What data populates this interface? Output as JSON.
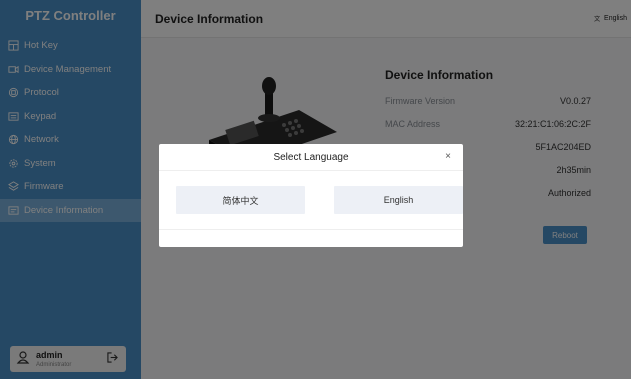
{
  "sidebar": {
    "brand": "PTZ Controller",
    "items": [
      {
        "label": "Hot Key",
        "icon": "hotkey-icon"
      },
      {
        "label": "Device Management",
        "icon": "device-management-icon"
      },
      {
        "label": "Protocol",
        "icon": "protocol-icon"
      },
      {
        "label": "Keypad",
        "icon": "keypad-icon"
      },
      {
        "label": "Network",
        "icon": "network-icon"
      },
      {
        "label": "System",
        "icon": "system-icon"
      },
      {
        "label": "Firmware",
        "icon": "firmware-icon"
      },
      {
        "label": "Device Information",
        "icon": "device-information-icon"
      }
    ],
    "active_index": 7,
    "user": {
      "name": "admin",
      "role": "Administrator"
    }
  },
  "header": {
    "title": "Device Information",
    "language": "English"
  },
  "info": {
    "heading": "Device Information",
    "rows": [
      {
        "label": "Firmware Version",
        "value": "V0.0.27"
      },
      {
        "label": "MAC Address",
        "value": "32:21:C1:06:2C:2F"
      },
      {
        "label": "",
        "value": "5F1AC204ED"
      },
      {
        "label": "",
        "value": "2h35min"
      },
      {
        "label": "",
        "value": "Authorized"
      }
    ],
    "reboot_label": "Reboot"
  },
  "modal": {
    "title": "Select Language",
    "close": "×",
    "options": [
      "简体中文",
      "English"
    ]
  },
  "colors": {
    "sidebar": "#4a90c8",
    "accent": "#4a90c8",
    "overlay": "rgba(0,0,0,0.5)"
  }
}
